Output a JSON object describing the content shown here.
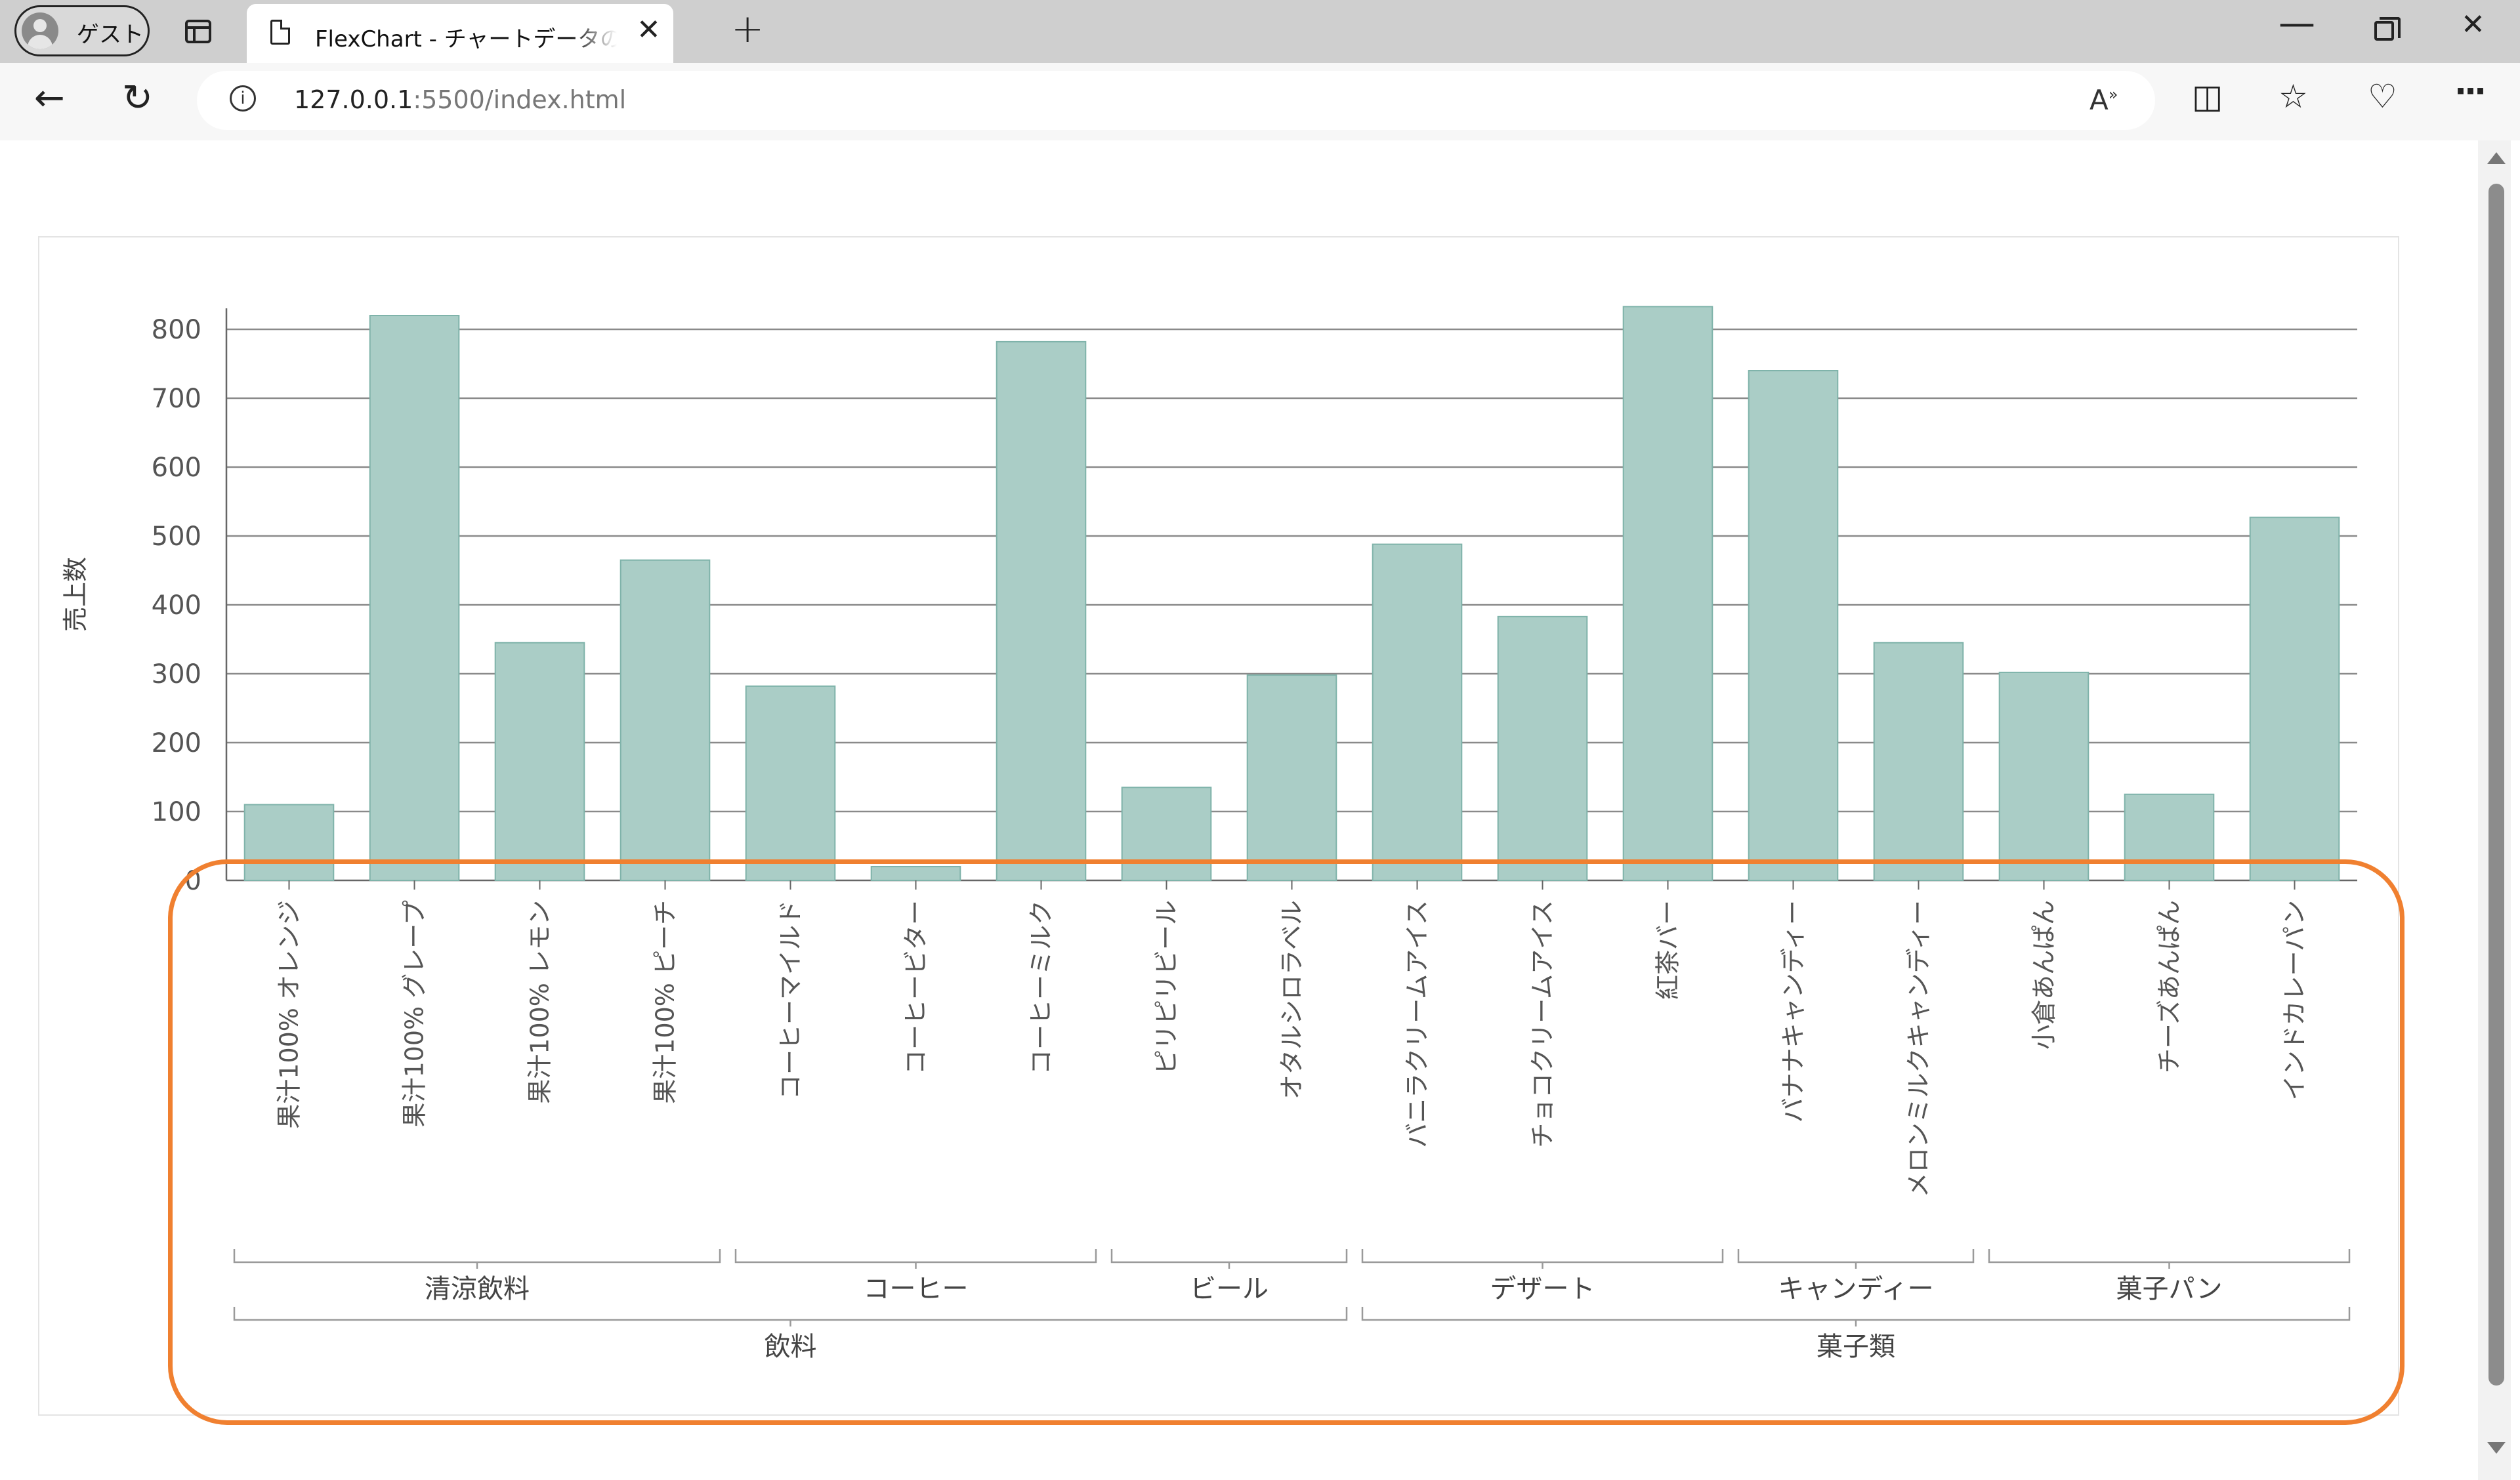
{
  "browser": {
    "profile_label": "ゲスト",
    "tab_title": "FlexChart - チャートデータのグループ化",
    "close_glyph": "✕",
    "new_tab_glyph": "+",
    "url_host": "127.0.0.1",
    "url_rest": ":5500/index.html",
    "read_aloud": "A⁾",
    "info_glyph": "i"
  },
  "highlight_color": "#f08030",
  "chart_data": {
    "type": "bar",
    "ylabel": "売上数",
    "xlabel": "",
    "ylim": [
      0,
      830
    ],
    "yticks": [
      0,
      100,
      200,
      300,
      400,
      500,
      600,
      700,
      800
    ],
    "grid": true,
    "bar_color": "#aacdc6",
    "bar_stroke": "#7fb3aa",
    "categories": [
      "果汁100% オレンジ",
      "果汁100% グレープ",
      "果汁100% レモン",
      "果汁100% ピーチ",
      "コーヒーマイルド",
      "コーヒービター",
      "コーヒーミルク",
      "ピリピリビール",
      "オタルシロラベル",
      "バニラクリームアイス",
      "チョコクリームアイス",
      "紅茶バー",
      "バナナキャンディー",
      "メロンミルクキャンディー",
      "小倉あんぱん",
      "チーズあんぱん",
      "インドカレーパン"
    ],
    "values": [
      110,
      820,
      345,
      465,
      282,
      20,
      782,
      135,
      298,
      488,
      383,
      833,
      740,
      345,
      302,
      125,
      527
    ],
    "groups_level1": [
      {
        "label": "清涼飲料",
        "start": 0,
        "end": 3
      },
      {
        "label": "コーヒー",
        "start": 4,
        "end": 6
      },
      {
        "label": "ビール",
        "start": 7,
        "end": 8
      },
      {
        "label": "デザート",
        "start": 9,
        "end": 11
      },
      {
        "label": "キャンディー",
        "start": 12,
        "end": 13
      },
      {
        "label": "菓子パン",
        "start": 14,
        "end": 16
      }
    ],
    "groups_level2": [
      {
        "label": "飲料",
        "start": 0,
        "end": 8
      },
      {
        "label": "菓子類",
        "start": 9,
        "end": 16
      }
    ]
  }
}
